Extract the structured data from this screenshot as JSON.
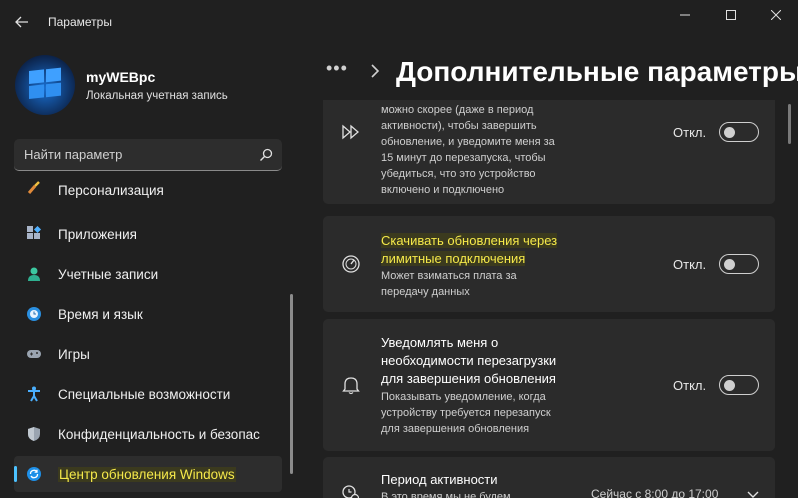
{
  "window": {
    "title": "Параметры",
    "back_icon": "arrow-left-icon",
    "controls": [
      "minimize-icon",
      "maximize-icon",
      "close-icon"
    ]
  },
  "user": {
    "name": "myWEBpc",
    "account": "Локальная учетная запись"
  },
  "search": {
    "placeholder": "Найти параметр",
    "icon": "search-icon"
  },
  "sidebar": {
    "items": [
      {
        "label": "Персонализация",
        "icon": "brush-icon",
        "active": false
      },
      {
        "label": "Приложения",
        "icon": "apps-icon",
        "active": false
      },
      {
        "label": "Учетные записи",
        "icon": "person-icon",
        "active": false
      },
      {
        "label": "Время и язык",
        "icon": "globe-clock-icon",
        "active": false
      },
      {
        "label": "Игры",
        "icon": "gamepad-icon",
        "active": false
      },
      {
        "label": "Специальные возможности",
        "icon": "accessibility-icon",
        "active": false
      },
      {
        "label": "Конфиденциальность и безопас",
        "icon": "shield-icon",
        "active": false
      },
      {
        "label": "Центр обновления Windows",
        "icon": "sync-icon",
        "active": true
      }
    ]
  },
  "header": {
    "breadcrumb_more": "•••",
    "title": "Дополнительные параметры"
  },
  "cards": [
    {
      "icon": "fast-forward-icon",
      "desc_lines": [
        "можно скорее (даже в период",
        "активности), чтобы завершить",
        "обновление, и уведомите меня за",
        "15 минут до перезапуска, чтобы",
        "убедиться, что это устройство",
        "включено и подключено"
      ],
      "toggle_label": "Откл.",
      "toggle_on": false
    },
    {
      "icon": "speedometer-icon",
      "title_lines": [
        "Скачивать обновления через",
        "лимитные подключения"
      ],
      "desc_lines": [
        "Может взиматься плата за",
        "передачу данных"
      ],
      "toggle_label": "Откл.",
      "toggle_on": false
    },
    {
      "icon": "bell-icon",
      "title_lines": [
        "Уведомлять меня о",
        "необходимости перезагрузки",
        "для завершения обновления"
      ],
      "desc_lines": [
        "Показывать уведомление, когда",
        "устройству требуется перезапуск",
        "для завершения обновления"
      ],
      "toggle_label": "Откл.",
      "toggle_on": false
    },
    {
      "icon": "clock-settings-icon",
      "title_lines": [
        "Период активности"
      ],
      "desc_lines": [
        "В это время мы не будем"
      ],
      "value": "Сейчас с 8:00 до 17:00",
      "expand_icon": "chevron-down-icon"
    }
  ],
  "colors": {
    "background": "#202020",
    "card": "#2b2b2b",
    "accent": "#4cc2ff",
    "highlight_text": "#f5e94a"
  }
}
